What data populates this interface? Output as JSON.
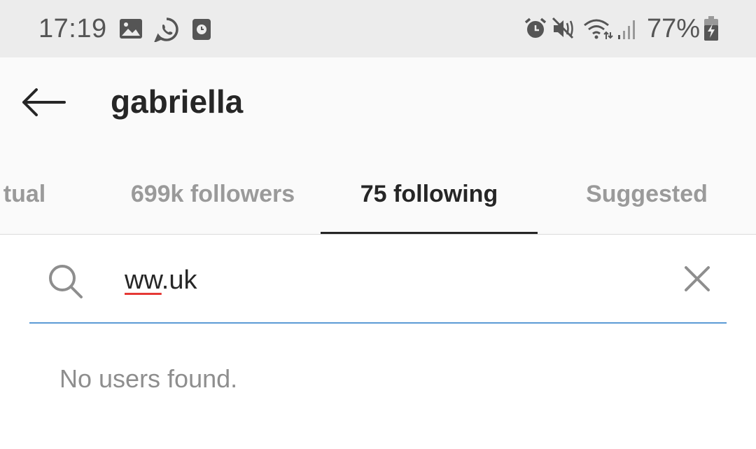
{
  "status_bar": {
    "time": "17:19",
    "battery": "77%",
    "left_icons": [
      "gallery-icon",
      "whatsapp-icon",
      "screen-recorder-icon"
    ],
    "right_icons": [
      "alarm-icon",
      "mute-icon",
      "wifi-icon",
      "signal-icon",
      "battery-charging-icon"
    ]
  },
  "header": {
    "title": "gabriella",
    "back_icon": "back-arrow-icon"
  },
  "tabs": [
    {
      "label": "tual",
      "active": false
    },
    {
      "label": "699k followers",
      "active": false
    },
    {
      "label": "75 following",
      "active": true
    },
    {
      "label": "Suggested",
      "active": false
    }
  ],
  "search": {
    "value_underlined": "ww",
    "value_rest": ".uk",
    "icon": "search-icon",
    "clear_icon": "close-icon",
    "accent_color": "#5b9bd5"
  },
  "results": {
    "empty_message": "No users found."
  }
}
